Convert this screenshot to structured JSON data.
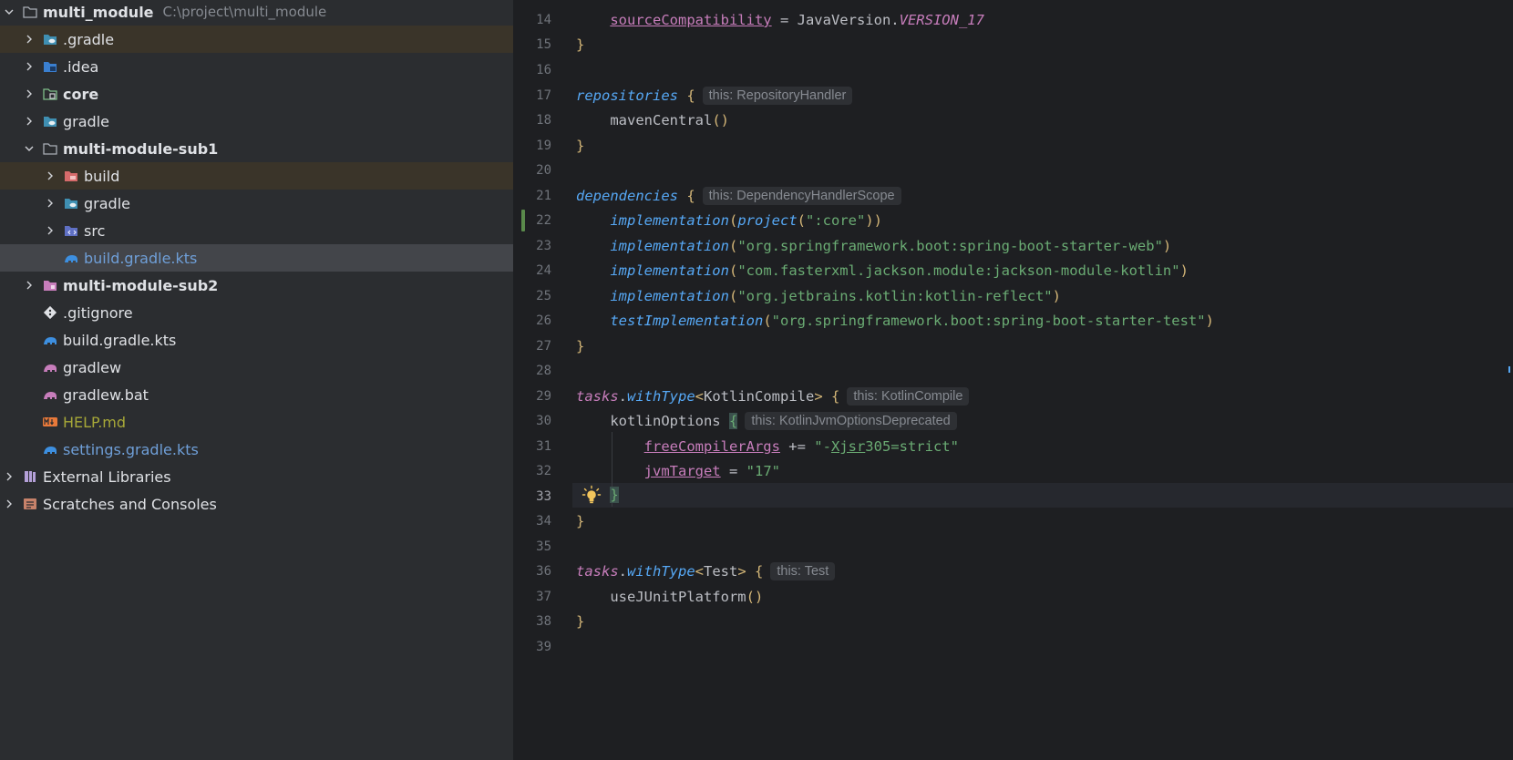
{
  "project_tree": {
    "root": {
      "label": "multi_module",
      "path": "C:\\project\\multi_module"
    },
    "items": [
      {
        "label": ".gradle"
      },
      {
        "label": ".idea"
      },
      {
        "label": "core"
      },
      {
        "label": "gradle"
      },
      {
        "label": "multi-module-sub1"
      },
      {
        "label": "build"
      },
      {
        "label": "gradle"
      },
      {
        "label": "src"
      },
      {
        "label": "build.gradle.kts"
      },
      {
        "label": "multi-module-sub2"
      },
      {
        "label": ".gitignore"
      },
      {
        "label": "build.gradle.kts"
      },
      {
        "label": "gradlew"
      },
      {
        "label": "gradlew.bat"
      },
      {
        "label": "HELP.md"
      },
      {
        "label": "settings.gradle.kts"
      },
      {
        "label": "External Libraries"
      },
      {
        "label": "Scratches and Consoles"
      }
    ]
  },
  "editor": {
    "line_numbers": [
      "14",
      "15",
      "16",
      "17",
      "18",
      "19",
      "20",
      "21",
      "22",
      "23",
      "24",
      "25",
      "26",
      "27",
      "28",
      "29",
      "30",
      "31",
      "32",
      "33",
      "34",
      "35",
      "36",
      "37",
      "38",
      "39"
    ],
    "current_line": "33",
    "tokens": {
      "l14_prop": "sourceCompatibility",
      "l14_eq": " = JavaVersion.",
      "l14_const": "VERSION_17",
      "close_brace": "}",
      "l17_fn": "repositories",
      "l17_hint": "this: RepositoryHandler",
      "l18_fn": "mavenCentral",
      "l21_fn": "dependencies",
      "l21_hint": "this: DependencyHandlerScope",
      "impl": "implementation",
      "l22_project": "project",
      "l22_str": "\":core\"",
      "l23_str": "\"org.springframework.boot:spring-boot-starter-web\"",
      "l24_str": "\"com.fasterxml.jackson.module:jackson-module-kotlin\"",
      "l25_str": "\"org.jetbrains.kotlin:kotlin-reflect\"",
      "l26_fn": "testImplementation",
      "l26_str": "\"org.springframework.boot:spring-boot-starter-test\"",
      "tasks": "tasks",
      "with_type": "withType",
      "l29_type": "KotlinCompile",
      "l29_hint": "this: KotlinCompile",
      "l30_name": "kotlinOptions",
      "l30_hint": "this: KotlinJvmOptionsDeprecated",
      "l31_prop": "freeCompilerArgs",
      "l31_op": " += ",
      "l31_str_a": "\"-",
      "l31_str_b": "Xjsr",
      "l31_str_c": "305=strict\"",
      "l32_prop": "jvmTarget",
      "l32_op": " = ",
      "l32_str": "\"17\"",
      "l36_type": "Test",
      "l36_hint": "this: Test",
      "l37_fn": "useJUnitPlatform"
    }
  },
  "colors": {
    "sidebar_bg": "#2b2d30",
    "editor_bg": "#1e1f22",
    "function": "#56a8f5",
    "property": "#c77dbb",
    "string": "#6aab73",
    "brace": "#d5b778"
  }
}
